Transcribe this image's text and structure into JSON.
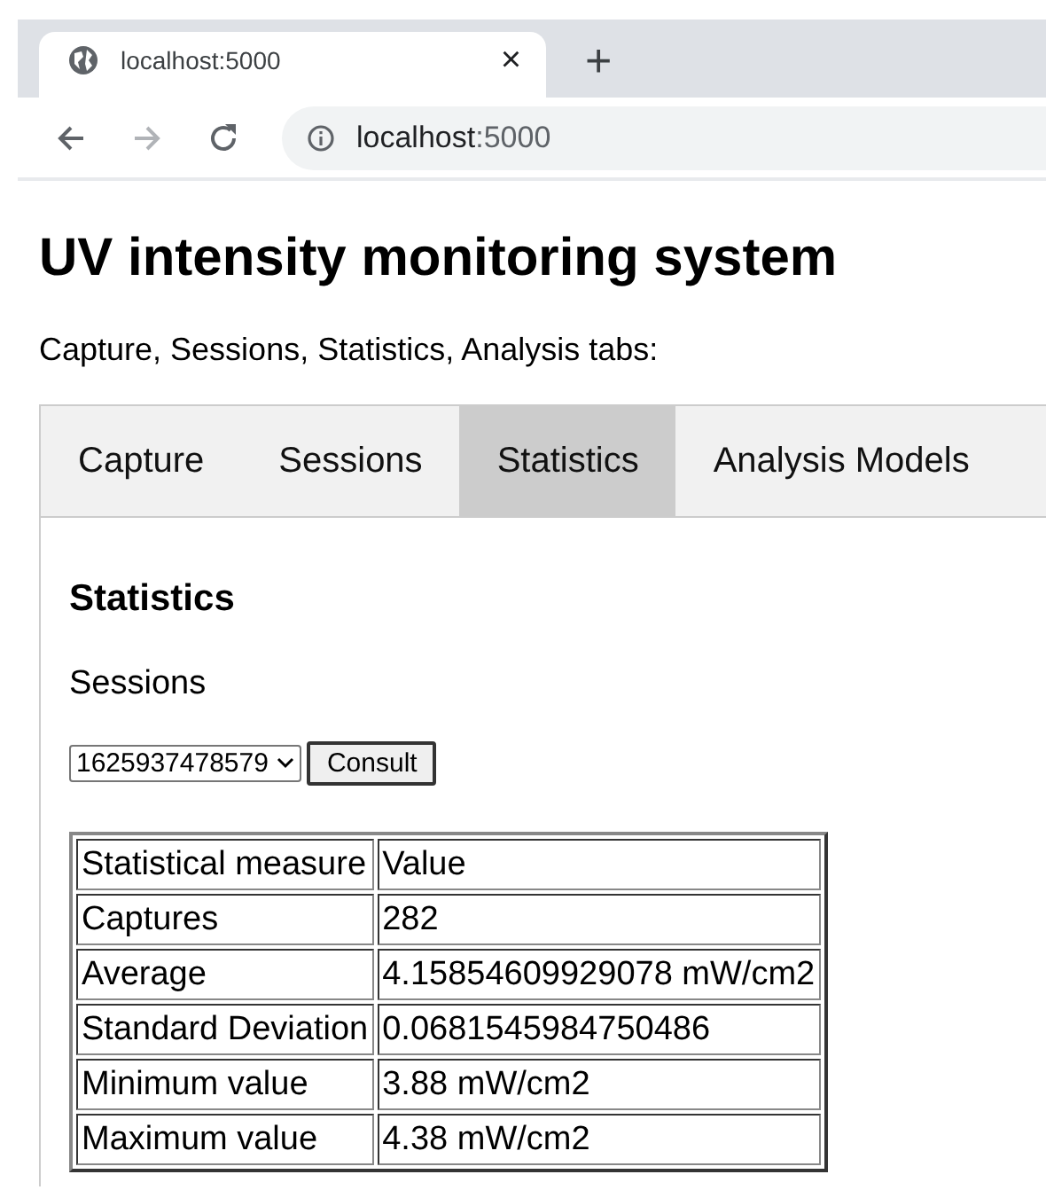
{
  "browser_tab": {
    "title": "localhost:5000",
    "close": "×",
    "new_tab": "+"
  },
  "address_bar": {
    "host": "localhost",
    "port": ":5000"
  },
  "heading": "UV intensity monitoring system",
  "subtitle": "Capture, Sessions, Statistics, Analysis tabs:",
  "tabs": [
    {
      "label": "Capture",
      "selected": false
    },
    {
      "label": "Sessions",
      "selected": false
    },
    {
      "label": "Statistics",
      "selected": true
    },
    {
      "label": "Analysis Models",
      "selected": false
    }
  ],
  "panel": {
    "title": "Statistics",
    "sessions_label": "Sessions",
    "session_select": "1625937478579",
    "consult_button": "Consult"
  },
  "table": {
    "columns": [
      "Statistical measure",
      "Value"
    ],
    "rows": [
      [
        "Captures",
        "282"
      ],
      [
        "Average",
        "4.15854609929078 mW/cm2"
      ],
      [
        "Standard Deviation",
        "0.0681545984750486"
      ],
      [
        "Minimum value",
        "3.88 mW/cm2"
      ],
      [
        "Maximum value",
        "4.38 mW/cm2"
      ]
    ]
  }
}
